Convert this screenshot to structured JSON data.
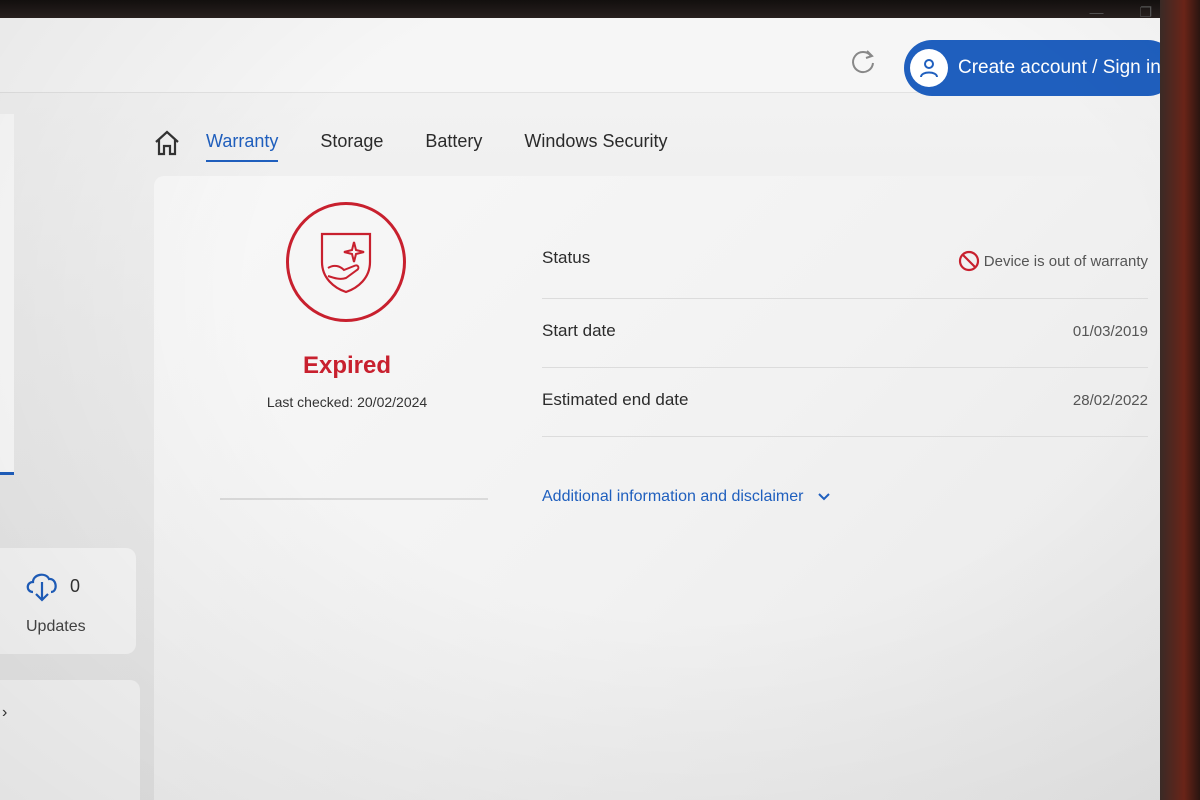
{
  "topbar": {
    "account_label": "Create account / Sign in"
  },
  "sidebar": {
    "updates": {
      "count": "0",
      "label": "Updates"
    }
  },
  "tabs": [
    {
      "label": "Warranty",
      "active": true
    },
    {
      "label": "Storage",
      "active": false
    },
    {
      "label": "Battery",
      "active": false
    },
    {
      "label": "Windows Security",
      "active": false
    }
  ],
  "warranty": {
    "status_title": "Expired",
    "last_checked": "Last checked: 20/02/2024",
    "rows": [
      {
        "label": "Status",
        "value": "Device is out of warranty"
      },
      {
        "label": "Start date",
        "value": "01/03/2019"
      },
      {
        "label": "Estimated end date",
        "value": "28/02/2022"
      }
    ],
    "disclaimer_label": "Additional information and disclaimer"
  },
  "icons": {
    "home": "home-icon",
    "refresh": "refresh-icon",
    "account": "user-icon",
    "shield": "shield-hand-icon",
    "blocked": "prohibited-icon",
    "updates": "cloud-download-icon"
  },
  "colors": {
    "accent": "#1f5fbe",
    "alert": "#c8202e"
  }
}
